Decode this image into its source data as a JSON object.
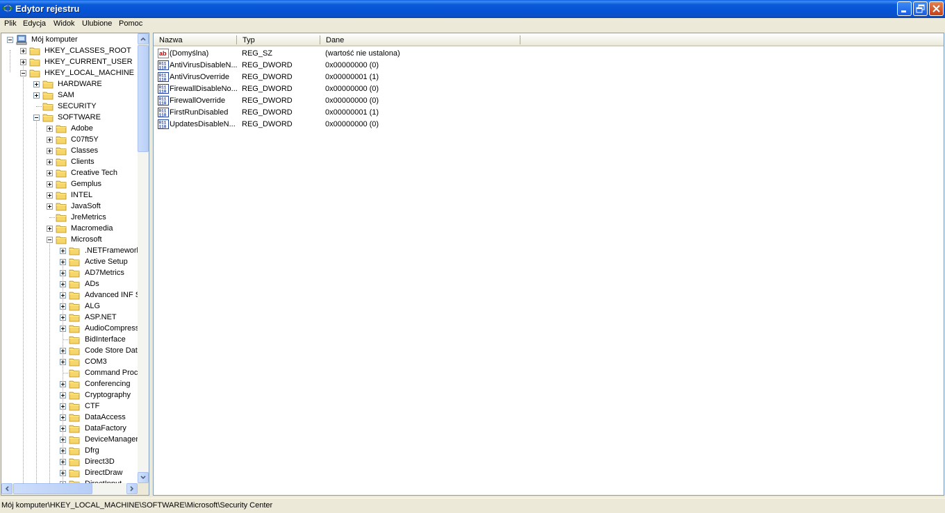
{
  "window": {
    "title": "Edytor rejestru"
  },
  "menu": [
    "Plik",
    "Edycja",
    "Widok",
    "Ulubione",
    "Pomoc"
  ],
  "tree": [
    {
      "label": "Mój komputer",
      "level": 0,
      "expander": "minus",
      "icon": "computer-icon"
    },
    {
      "label": "HKEY_CLASSES_ROOT",
      "level": 1,
      "expander": "plus",
      "icon": "folder-icon"
    },
    {
      "label": "HKEY_CURRENT_USER",
      "level": 1,
      "expander": "plus",
      "icon": "folder-icon"
    },
    {
      "label": "HKEY_LOCAL_MACHINE",
      "level": 1,
      "expander": "minus",
      "icon": "folder-icon"
    },
    {
      "label": "HARDWARE",
      "level": 2,
      "expander": "plus",
      "icon": "folder-icon"
    },
    {
      "label": "SAM",
      "level": 2,
      "expander": "plus",
      "icon": "folder-icon"
    },
    {
      "label": "SECURITY",
      "level": 2,
      "expander": "none",
      "icon": "folder-icon"
    },
    {
      "label": "SOFTWARE",
      "level": 2,
      "expander": "minus",
      "icon": "folder-icon"
    },
    {
      "label": "Adobe",
      "level": 3,
      "expander": "plus",
      "icon": "folder-icon"
    },
    {
      "label": "C07ft5Y",
      "level": 3,
      "expander": "plus",
      "icon": "folder-icon"
    },
    {
      "label": "Classes",
      "level": 3,
      "expander": "plus",
      "icon": "folder-icon"
    },
    {
      "label": "Clients",
      "level": 3,
      "expander": "plus",
      "icon": "folder-icon"
    },
    {
      "label": "Creative Tech",
      "level": 3,
      "expander": "plus",
      "icon": "folder-icon"
    },
    {
      "label": "Gemplus",
      "level": 3,
      "expander": "plus",
      "icon": "folder-icon"
    },
    {
      "label": "INTEL",
      "level": 3,
      "expander": "plus",
      "icon": "folder-icon"
    },
    {
      "label": "JavaSoft",
      "level": 3,
      "expander": "plus",
      "icon": "folder-icon"
    },
    {
      "label": "JreMetrics",
      "level": 3,
      "expander": "none",
      "icon": "folder-icon"
    },
    {
      "label": "Macromedia",
      "level": 3,
      "expander": "plus",
      "icon": "folder-icon"
    },
    {
      "label": "Microsoft",
      "level": 3,
      "expander": "minus",
      "icon": "folder-icon"
    },
    {
      "label": ".NETFramework",
      "level": 4,
      "expander": "plus",
      "icon": "folder-icon"
    },
    {
      "label": "Active Setup",
      "level": 4,
      "expander": "plus",
      "icon": "folder-icon"
    },
    {
      "label": "AD7Metrics",
      "level": 4,
      "expander": "plus",
      "icon": "folder-icon"
    },
    {
      "label": "ADs",
      "level": 4,
      "expander": "plus",
      "icon": "folder-icon"
    },
    {
      "label": "Advanced INF S",
      "level": 4,
      "expander": "plus",
      "icon": "folder-icon"
    },
    {
      "label": "ALG",
      "level": 4,
      "expander": "plus",
      "icon": "folder-icon"
    },
    {
      "label": "ASP.NET",
      "level": 4,
      "expander": "plus",
      "icon": "folder-icon"
    },
    {
      "label": "AudioCompressi",
      "level": 4,
      "expander": "plus",
      "icon": "folder-icon"
    },
    {
      "label": "BidInterface",
      "level": 4,
      "expander": "none",
      "icon": "folder-icon"
    },
    {
      "label": "Code Store Data",
      "level": 4,
      "expander": "plus",
      "icon": "folder-icon"
    },
    {
      "label": "COM3",
      "level": 4,
      "expander": "plus",
      "icon": "folder-icon"
    },
    {
      "label": "Command Proce",
      "level": 4,
      "expander": "none",
      "icon": "folder-icon"
    },
    {
      "label": "Conferencing",
      "level": 4,
      "expander": "plus",
      "icon": "folder-icon"
    },
    {
      "label": "Cryptography",
      "level": 4,
      "expander": "plus",
      "icon": "folder-icon"
    },
    {
      "label": "CTF",
      "level": 4,
      "expander": "plus",
      "icon": "folder-icon"
    },
    {
      "label": "DataAccess",
      "level": 4,
      "expander": "plus",
      "icon": "folder-icon"
    },
    {
      "label": "DataFactory",
      "level": 4,
      "expander": "plus",
      "icon": "folder-icon"
    },
    {
      "label": "DeviceManager",
      "level": 4,
      "expander": "plus",
      "icon": "folder-icon"
    },
    {
      "label": "Dfrg",
      "level": 4,
      "expander": "plus",
      "icon": "folder-icon"
    },
    {
      "label": "Direct3D",
      "level": 4,
      "expander": "plus",
      "icon": "folder-icon"
    },
    {
      "label": "DirectDraw",
      "level": 4,
      "expander": "plus",
      "icon": "folder-icon"
    },
    {
      "label": "DirectInput",
      "level": 4,
      "expander": "plus",
      "icon": "folder-icon"
    }
  ],
  "list": {
    "columns": [
      "Nazwa",
      "Typ",
      "Dane"
    ],
    "rows": [
      {
        "name": "(Domyślna)",
        "type": "REG_SZ",
        "data": "(wartość nie ustalona)",
        "icon": "string-value-icon"
      },
      {
        "name": "AntiVirusDisableN...",
        "type": "REG_DWORD",
        "data": "0x00000000 (0)",
        "icon": "binary-value-icon"
      },
      {
        "name": "AntiVirusOverride",
        "type": "REG_DWORD",
        "data": "0x00000001 (1)",
        "icon": "binary-value-icon"
      },
      {
        "name": "FirewallDisableNo...",
        "type": "REG_DWORD",
        "data": "0x00000000 (0)",
        "icon": "binary-value-icon"
      },
      {
        "name": "FirewallOverride",
        "type": "REG_DWORD",
        "data": "0x00000000 (0)",
        "icon": "binary-value-icon"
      },
      {
        "name": "FirstRunDisabled",
        "type": "REG_DWORD",
        "data": "0x00000001 (1)",
        "icon": "binary-value-icon"
      },
      {
        "name": "UpdatesDisableN...",
        "type": "REG_DWORD",
        "data": "0x00000000 (0)",
        "icon": "binary-value-icon"
      }
    ]
  },
  "status": {
    "path": "Mój komputer\\HKEY_LOCAL_MACHINE\\SOFTWARE\\Microsoft\\Security Center"
  },
  "colors": {
    "titlebar": "#0A5FE0",
    "folder": "#F6D56A",
    "list_border": "#7F9DB9"
  }
}
